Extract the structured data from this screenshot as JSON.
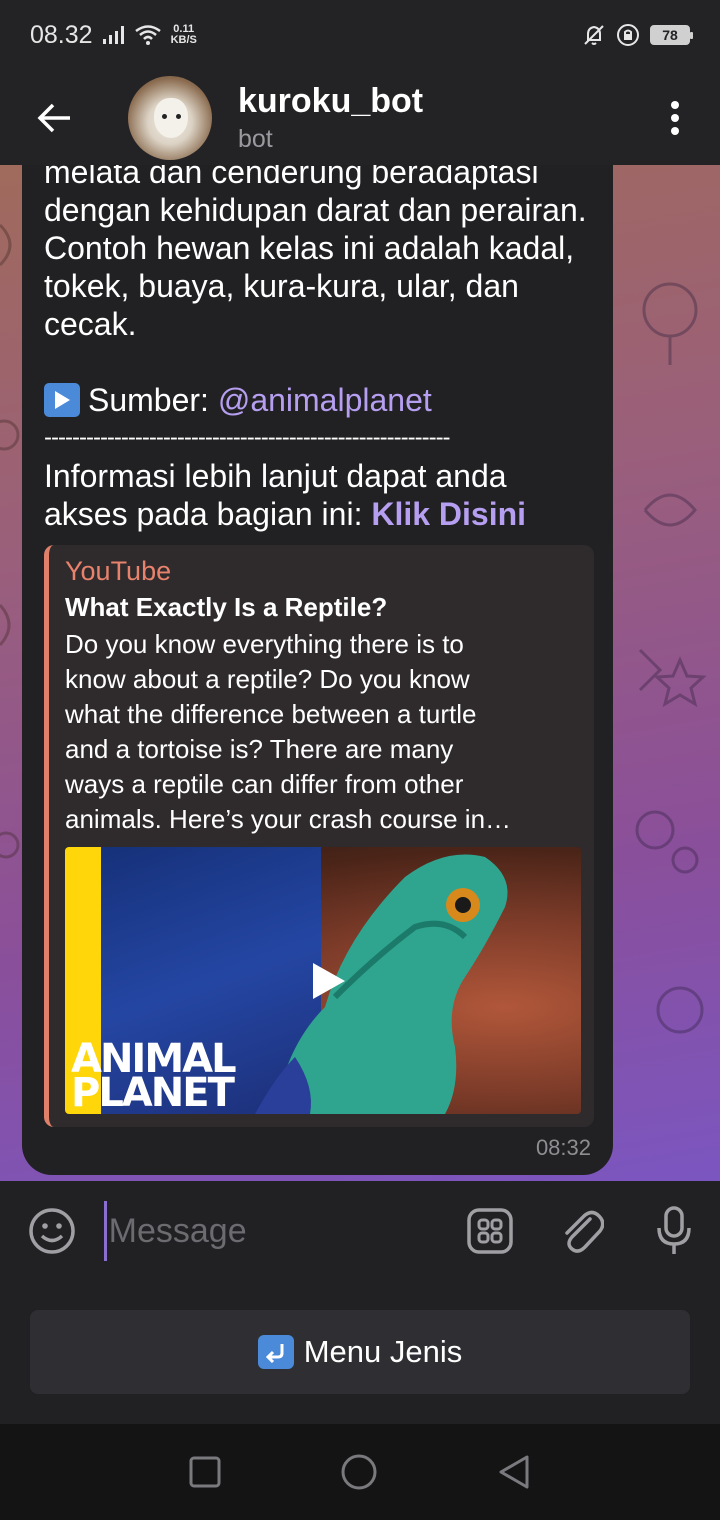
{
  "status_bar": {
    "time": "08.32",
    "net_speed_value": "0.11",
    "net_speed_unit": "KB/S",
    "battery": "78"
  },
  "header": {
    "title": "kuroku_bot",
    "subtitle": "bot"
  },
  "message": {
    "body": "melata dan cenderung beradaptasi\ndengan kehidupan darat dan perairan.\nContoh hewan kelas ini adalah kadal,\ntokek, buaya, kura-kura, ular, dan\ncecak.",
    "source_label": "Sumber:",
    "source_handle": "@animalplanet",
    "divider": "----------------------------------------------------------",
    "info_text": "Informasi lebih lanjut dapat anda\nakses pada bagian ini:",
    "info_link": "Klik Disini",
    "time": "08:32"
  },
  "preview": {
    "site": "YouTube",
    "title": "What Exactly Is a Reptile?",
    "description": "Do you know everything there is to\nknow about a reptile? Do you know\nwhat the difference between a turtle\nand a tortoise is? There are many\nways a reptile can differ from other\nanimals. Here’s your crash course in…",
    "thumb_logo_line1": "ANIMAL",
    "thumb_logo_line2": "PLANET"
  },
  "input": {
    "placeholder": "Message"
  },
  "keyboard": {
    "button_label": "Menu Jenis"
  },
  "colors": {
    "accent": "#b69ef0",
    "preview_bar": "#e0806a",
    "bubble": "#212123"
  }
}
